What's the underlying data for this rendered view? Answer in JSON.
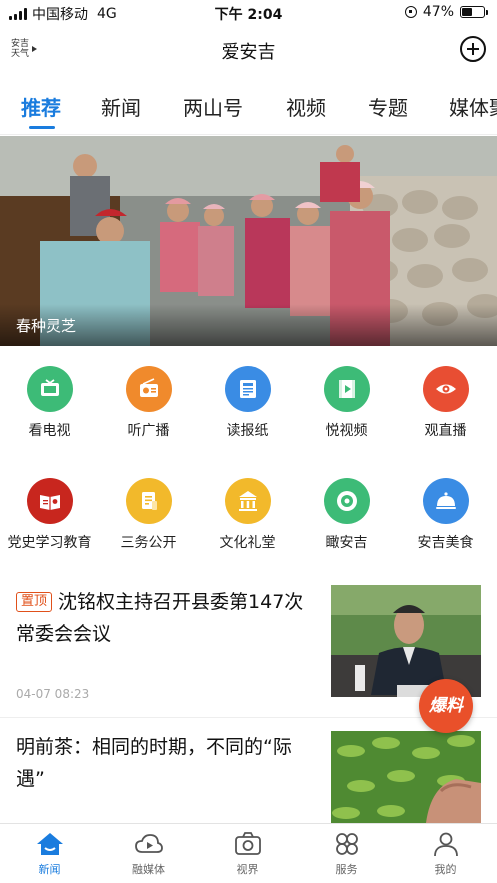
{
  "status_bar": {
    "carrier": "中国移动",
    "network": "4G",
    "time": "下午 2:04",
    "battery_percent_text": "47%",
    "battery_level": 0.47
  },
  "header": {
    "weather_line1": "安吉",
    "weather_line2": "天气",
    "title": "爱安吉"
  },
  "tabs": [
    {
      "label": "推荐",
      "active": true
    },
    {
      "label": "新闻"
    },
    {
      "label": "两山号"
    },
    {
      "label": "视频"
    },
    {
      "label": "专题"
    },
    {
      "label": "媒体聚"
    }
  ],
  "banner": {
    "caption": "春种灵芝"
  },
  "grid": [
    {
      "label": "看电视",
      "icon": "tv-icon",
      "color": "#3dbb77"
    },
    {
      "label": "听广播",
      "icon": "radio-icon",
      "color": "#f08a2c"
    },
    {
      "label": "读报纸",
      "icon": "newspaper-icon",
      "color": "#3a8ce4"
    },
    {
      "label": "悦视频",
      "icon": "video-icon",
      "color": "#3dbb77"
    },
    {
      "label": "观直播",
      "icon": "eye-icon",
      "color": "#e84e33"
    },
    {
      "label": "党史学习教育",
      "icon": "party-book-icon",
      "color": "#c8261e"
    },
    {
      "label": "三务公开",
      "icon": "document-icon",
      "color": "#f2b92b"
    },
    {
      "label": "文化礼堂",
      "icon": "hall-icon",
      "color": "#f2b92b"
    },
    {
      "label": "瞰安吉",
      "icon": "eye-circle-icon",
      "color": "#3dbb77"
    },
    {
      "label": "安吉美食",
      "icon": "food-cloche-icon",
      "color": "#3a8ce4"
    }
  ],
  "news": [
    {
      "badge": "置顶",
      "title": "沈铭权主持召开县委第147次常委会会议",
      "time": "04-07 08:23"
    },
    {
      "title": "明前茶：相同的时期，不同的“际遇”"
    }
  ],
  "fab": {
    "label": "爆料"
  },
  "bottom_nav": [
    {
      "label": "新闻",
      "icon": "home-icon",
      "active": true
    },
    {
      "label": "融媒体",
      "icon": "cloud-play-icon"
    },
    {
      "label": "视界",
      "icon": "camera-icon"
    },
    {
      "label": "服务",
      "icon": "grid-clover-icon"
    },
    {
      "label": "我的",
      "icon": "user-icon"
    }
  ],
  "colors": {
    "accent": "#1a7cde",
    "badge": "#e0501a",
    "fab": "#e9502a"
  }
}
